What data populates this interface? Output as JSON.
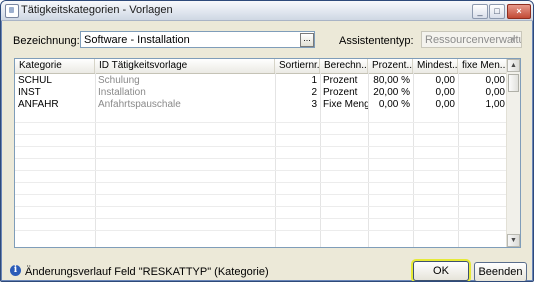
{
  "window": {
    "title": "Tätigkeitskategorien - Vorlagen",
    "minimize_label": "_",
    "maximize_label": "□",
    "close_label": "×"
  },
  "form": {
    "bezeichnung_label": "Bezeichnung:",
    "bezeichnung_value": "Software - Installation",
    "browse_label": "...",
    "assistententyp_label": "Assistententyp:",
    "assistententyp_value": "Ressourcenverwaltung",
    "assistententyp_arrow": "▼"
  },
  "grid": {
    "columns": [
      "Kategorie",
      "ID Tätigkeitsvorlage",
      "Sortiernr.",
      "Berechn...",
      "Prozent...",
      "Mindest...",
      "fixe Men..."
    ],
    "rows": [
      {
        "kategorie": "SCHUL",
        "vorlage": "Schulung",
        "sortiernr": "1",
        "berechnung": "Prozent",
        "prozent": "80,00 %",
        "mindest": "0,00",
        "fixe_menge": "0,00"
      },
      {
        "kategorie": "INST",
        "vorlage": "Installation",
        "sortiernr": "2",
        "berechnung": "Prozent",
        "prozent": "20,00 %",
        "mindest": "0,00",
        "fixe_menge": "0,00"
      },
      {
        "kategorie": "ANFAHR",
        "vorlage": "Anfahrtspauschale",
        "sortiernr": "3",
        "berechnung": "Fixe Menge",
        "prozent": "0,00 %",
        "mindest": "0,00",
        "fixe_menge": "1,00"
      }
    ],
    "scroll_up": "▲",
    "scroll_down": "▼"
  },
  "status": {
    "info_icon": "i",
    "text": "Änderungsverlauf Feld \"RESKATTYP\" (Kategorie)"
  },
  "buttons": {
    "ok": "OK",
    "beenden": "Beenden"
  }
}
